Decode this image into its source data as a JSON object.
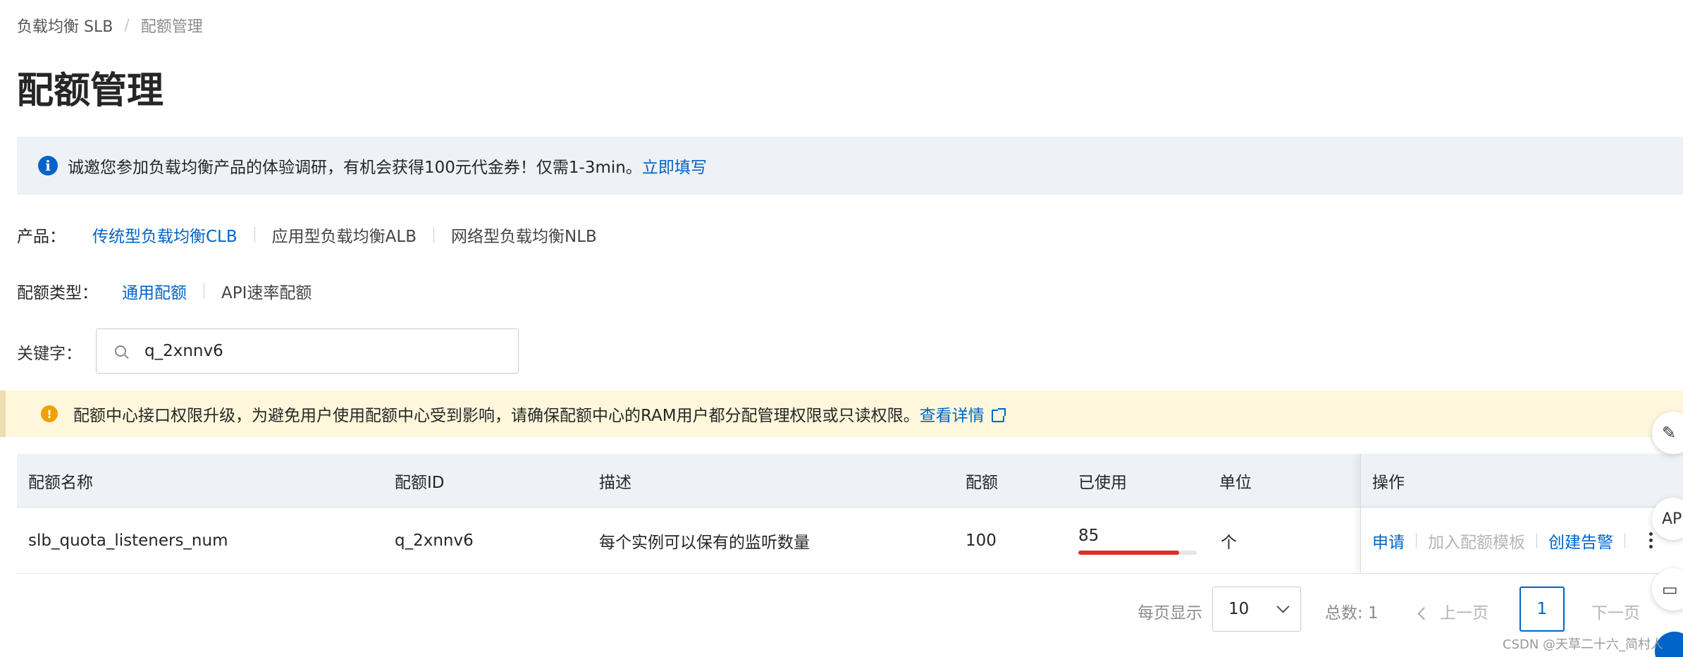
{
  "breadcrumb": {
    "parent": "负载均衡 SLB",
    "separator": "/",
    "current": "配额管理"
  },
  "page_title": "配额管理",
  "info_banner": {
    "text": "诚邀您参加负载均衡产品的体验调研，有机会获得100元代金券！仅需1-3min。",
    "link": "立即填写",
    "icon": "info-icon",
    "color": "#0064c8"
  },
  "product_filter": {
    "label": "产品：",
    "options": [
      "传统型负载均衡CLB",
      "应用型负载均衡ALB",
      "网络型负载均衡NLB"
    ],
    "active": "传统型负载均衡CLB"
  },
  "quota_type_filter": {
    "label": "配额类型：",
    "options": [
      "通用配额",
      "API速率配额"
    ],
    "active": "通用配额"
  },
  "keyword": {
    "label": "关键字：",
    "value": "q_2xnnv6",
    "icon": "search-icon"
  },
  "warning_banner": {
    "text": "配额中心接口权限升级，为避免用户使用配额中心受到影响，请确保配额中心的RAM用户都分配管理权限或只读权限。",
    "link": "查看详情",
    "icon": "warning-icon",
    "color": "#f0a000"
  },
  "table": {
    "columns": [
      "配额名称",
      "配额ID",
      "描述",
      "配额",
      "已使用",
      "单位",
      "操作"
    ],
    "rows": [
      {
        "name": "slb_quota_listeners_num",
        "id": "q_2xnnv6",
        "description": "每个实例可以保有的监听数量",
        "quota": "100",
        "used": "85",
        "used_fraction": 0.85,
        "unit": "个",
        "actions": [
          "申请",
          "加入配额模板",
          "创建告警"
        ]
      }
    ],
    "usage_color": "#d93026"
  },
  "pagination": {
    "page_size_label": "每页显示",
    "page_size": "10",
    "total": "总数: 1",
    "prev": "上一页",
    "current_page": "1",
    "next": "下一页"
  },
  "side_buttons": [
    "edit-icon",
    "api-icon",
    "feedback-icon"
  ],
  "watermark": "CSDN @天草二十六_简村人"
}
